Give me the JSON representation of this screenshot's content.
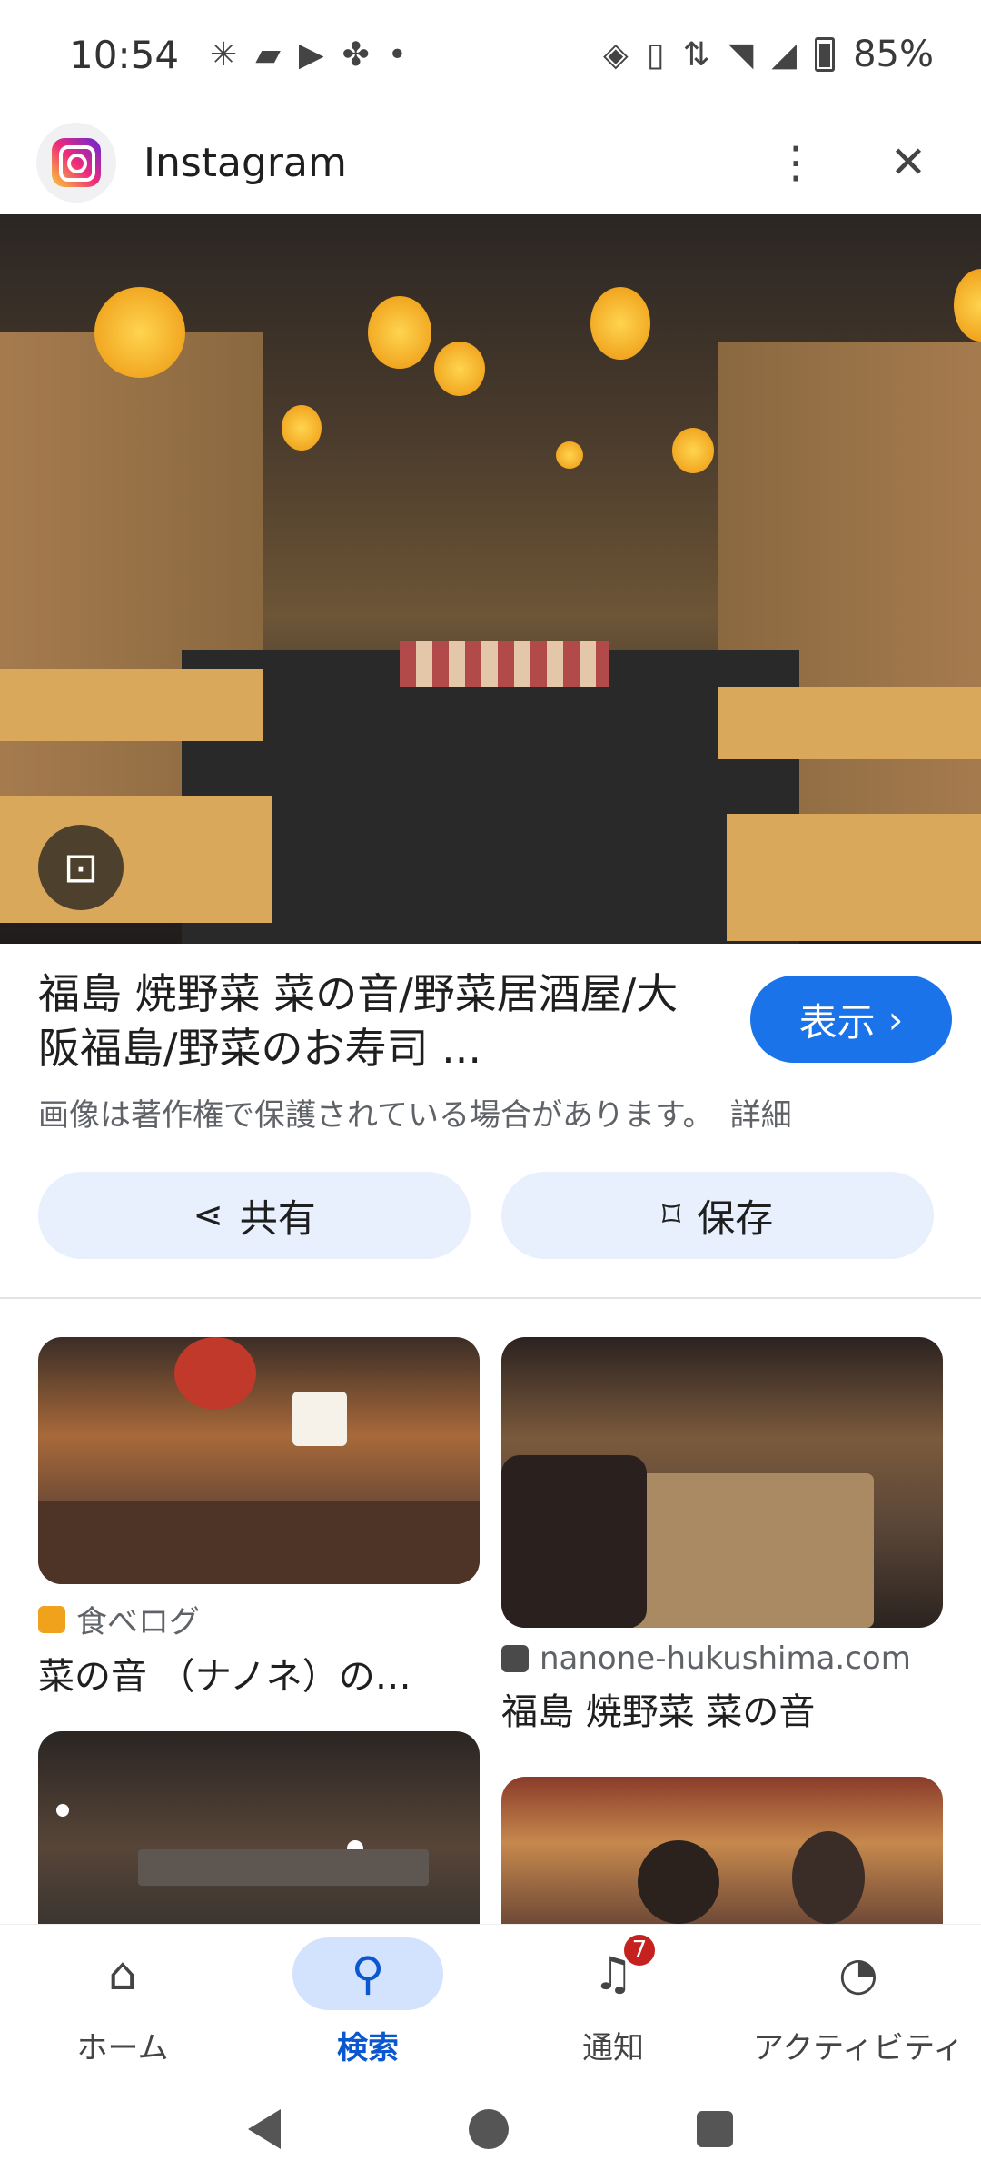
{
  "status_bar": {
    "time": "10:54",
    "battery": "85%"
  },
  "header": {
    "title": "Instagram",
    "logo_icon": "instagram-logo-icon",
    "menu_icon": "more-vert-icon",
    "close_icon": "close-icon"
  },
  "result": {
    "title": "福島 焼野菜 菜の音/野菜居酒屋/大阪福島/野菜のお寿司 ...",
    "visit_label": "表示",
    "copyright_note": "画像は著作権で保護されている場合があります。",
    "more_label": "詳細",
    "share_label": "共有",
    "save_label": "保存"
  },
  "related": [
    {
      "source": "食べログ",
      "title": "菜の音 （ナノネ）の…",
      "source_color": "#f0a21c"
    },
    {
      "source": "nanone-hukushima.com",
      "title": "福島 焼野菜 菜の音",
      "source_color": "#4a4a4a"
    }
  ],
  "bottom_nav": [
    {
      "label": "ホーム",
      "icon": "home-icon",
      "active": false
    },
    {
      "label": "検索",
      "icon": "search-icon",
      "active": true
    },
    {
      "label": "通知",
      "icon": "bell-icon",
      "active": false,
      "badge": "7"
    },
    {
      "label": "アクティビティ",
      "icon": "activity-history-icon",
      "active": false
    }
  ],
  "colors": {
    "accent": "#1a73e8",
    "pill": "#e8f0fe",
    "nav_active": "#0b57d0",
    "badge": "#c5221f"
  }
}
